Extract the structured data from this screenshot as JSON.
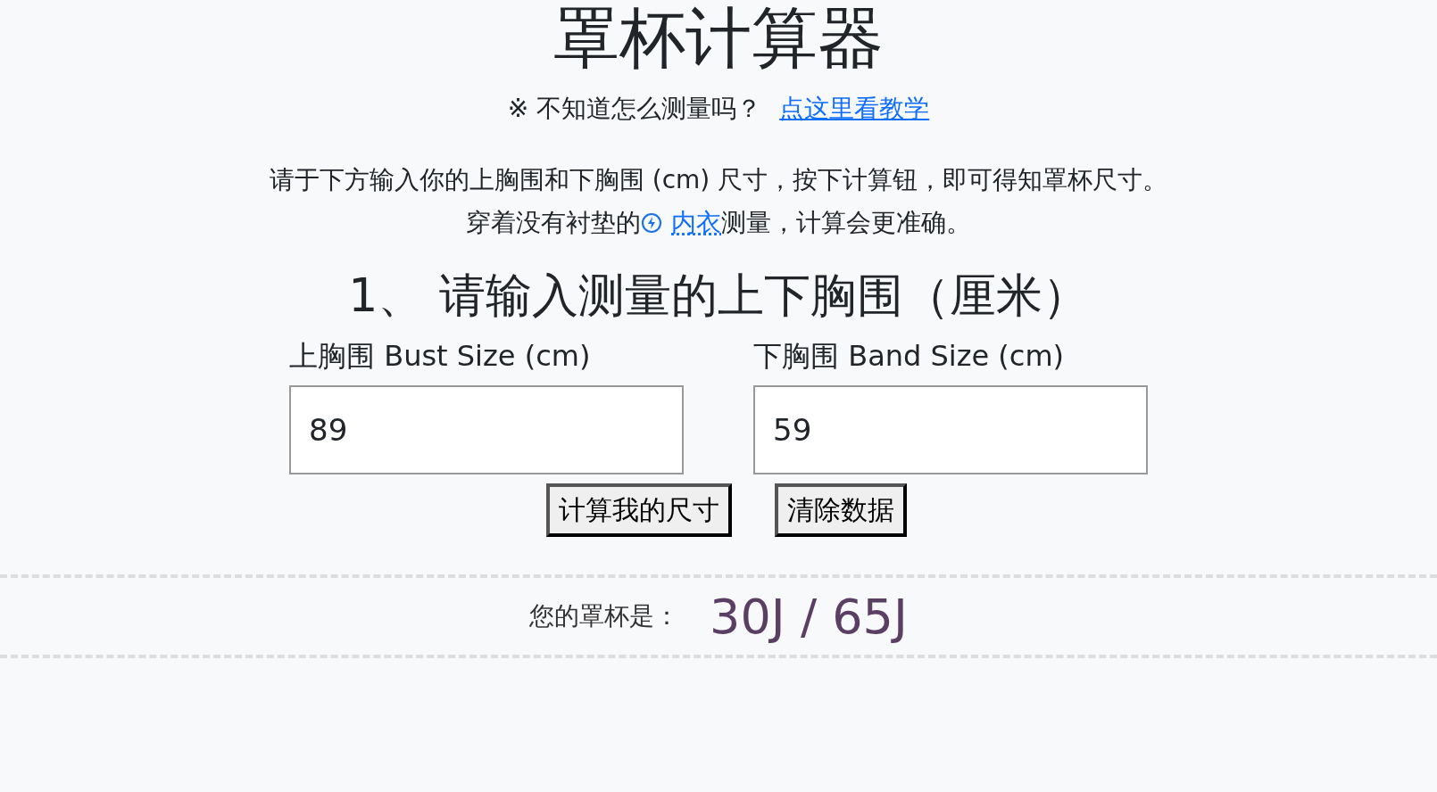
{
  "title": "罩杯计算器",
  "tutorial": {
    "prefix": "※ 不知道怎么测量吗？",
    "link": "点这里看教学"
  },
  "intro": "请于下方输入你的上胸围和下胸围 (cm) 尺寸，按下计算钮，即可得知罩杯尺寸。",
  "note": {
    "before": "穿着没有衬垫的",
    "link": "内衣",
    "after": "测量，计算会更准确。"
  },
  "step_heading": "1、 请输入测量的上下胸围（厘米）",
  "fields": [
    {
      "label": "上胸围 Bust Size (cm)",
      "value": "89"
    },
    {
      "label": "下胸围 Band Size (cm)",
      "value": "59"
    }
  ],
  "buttons": [
    "计算我的尺寸",
    "清除数据"
  ],
  "result": {
    "label": "您的罩杯是：",
    "value": "30J / 65J"
  }
}
